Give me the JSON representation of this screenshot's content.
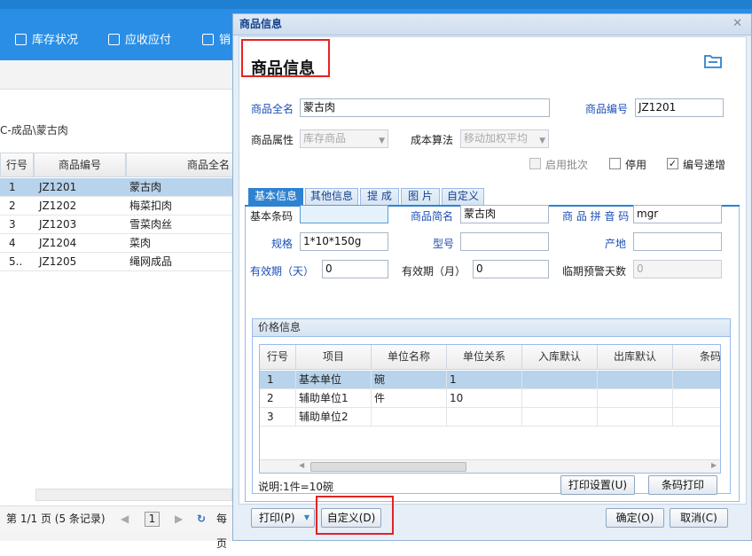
{
  "toolbar": {
    "items": [
      {
        "label": "库存状况"
      },
      {
        "label": "应收应付"
      },
      {
        "label": "销"
      }
    ]
  },
  "background": {
    "breadcrumb": "C-成品\\蒙古肉",
    "columns": [
      "行号",
      "商品编号",
      "商品全名"
    ],
    "rows": [
      {
        "no": "1",
        "code": "JZ1201",
        "name": "蒙古肉"
      },
      {
        "no": "2",
        "code": "JZ1202",
        "name": "梅菜扣肉"
      },
      {
        "no": "3",
        "code": "JZ1203",
        "name": "雪菜肉丝"
      },
      {
        "no": "4",
        "code": "JZ1204",
        "name": "菜肉"
      },
      {
        "no": "5..",
        "code": "JZ1205",
        "name": "绳网成品"
      }
    ],
    "pager": "第 1/1 页 (5 条记录)",
    "page_num": "1",
    "right_text": "每页"
  },
  "dialog": {
    "window_title": "商品信息",
    "close_glyph": "✕",
    "heading": "商品信息",
    "full_name_label": "商品全名",
    "full_name_value": "蒙古肉",
    "code_label": "商品编号",
    "code_value": "JZ1201",
    "attr_label": "商品属性",
    "attr_value": "库存商品",
    "cost_label": "成本算法",
    "cost_value": "移动加权平均",
    "batch_label": "启用批次",
    "stop_label": "停用",
    "auto_inc_label": "编号递增",
    "tabs": [
      "基本信息",
      "其他信息",
      "提 成",
      "图 片",
      "自定义"
    ],
    "barcode_label": "基本条码",
    "barcode_value": "",
    "short_name_label": "商品简名",
    "short_name_value": "蒙古肉",
    "pinyin_label": "商 品 拼 音 码",
    "pinyin_value": "mgr",
    "spec_label": "规格",
    "spec_value": "1*10*150g",
    "model_label": "型号",
    "model_value": "",
    "origin_label": "产地",
    "origin_value": "",
    "validity_day_label": "有效期（天）",
    "validity_day_value": "0",
    "validity_month_label": "有效期（月）",
    "validity_month_value": "0",
    "warn_days_label": "临期预警天数",
    "warn_days_value": "0",
    "price_title": "价格信息",
    "grid_columns": [
      "行号",
      "项目",
      "单位名称",
      "单位关系",
      "入库默认",
      "出库默认",
      "条码"
    ],
    "grid_rows": [
      {
        "no": "1",
        "item": "基本单位",
        "unit": "碗",
        "rel": "1"
      },
      {
        "no": "2",
        "item": "辅助单位1",
        "unit": "件",
        "rel": "10"
      },
      {
        "no": "3",
        "item": "辅助单位2",
        "unit": "",
        "rel": ""
      }
    ],
    "note": "说明:1件=10碗",
    "print_settings_btn": "打印设置(U)",
    "barcode_print_btn": "条码打印",
    "print_btn": "打印(P)",
    "custom_btn": "自定义(D)",
    "ok_btn": "确定(O)",
    "cancel_btn": "取消(C)"
  }
}
